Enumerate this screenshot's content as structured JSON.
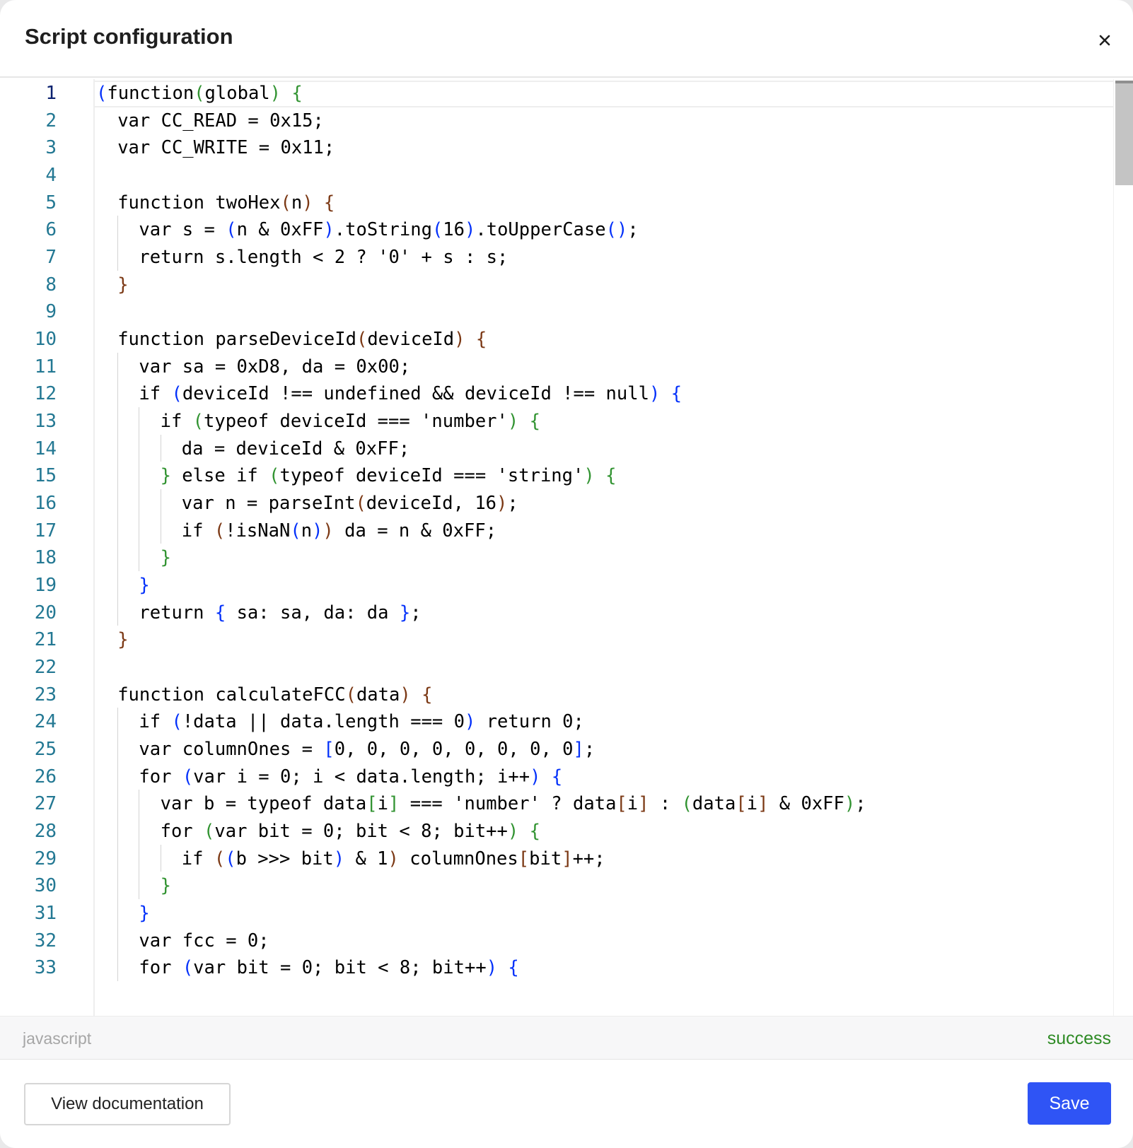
{
  "dialog": {
    "title": "Script configuration"
  },
  "editor": {
    "language": "javascript",
    "status": "success",
    "active_line": 1,
    "lines": [
      {
        "n": "1",
        "indent": 0,
        "parts": [
          [
            "(",
            "b1"
          ],
          [
            "function",
            ""
          ],
          [
            "(",
            "b2"
          ],
          [
            "global",
            ""
          ],
          [
            ")",
            "b2"
          ],
          [
            " ",
            ""
          ],
          [
            "{",
            "b2"
          ]
        ]
      },
      {
        "n": "2",
        "indent": 1,
        "parts": [
          [
            "var CC_READ = 0x15;",
            ""
          ]
        ]
      },
      {
        "n": "3",
        "indent": 1,
        "parts": [
          [
            "var CC_WRITE = 0x11;",
            ""
          ]
        ]
      },
      {
        "n": "4",
        "indent": 0,
        "parts": []
      },
      {
        "n": "5",
        "indent": 1,
        "parts": [
          [
            "function twoHex",
            ""
          ],
          [
            "(",
            "b3"
          ],
          [
            "n",
            ""
          ],
          [
            ")",
            "b3"
          ],
          [
            " ",
            ""
          ],
          [
            "{",
            "b3"
          ]
        ]
      },
      {
        "n": "6",
        "indent": 2,
        "parts": [
          [
            "var s = ",
            ""
          ],
          [
            "(",
            "b1"
          ],
          [
            "n & 0xFF",
            ""
          ],
          [
            ")",
            "b1"
          ],
          [
            ".toString",
            ""
          ],
          [
            "(",
            "b1"
          ],
          [
            "16",
            ""
          ],
          [
            ")",
            "b1"
          ],
          [
            ".toUpperCase",
            ""
          ],
          [
            "()",
            "b1"
          ],
          [
            ";",
            ""
          ]
        ]
      },
      {
        "n": "7",
        "indent": 2,
        "parts": [
          [
            "return s.length < 2 ? '0' + s : s;",
            ""
          ]
        ]
      },
      {
        "n": "8",
        "indent": 1,
        "parts": [
          [
            "}",
            "b3"
          ]
        ]
      },
      {
        "n": "9",
        "indent": 0,
        "parts": []
      },
      {
        "n": "10",
        "indent": 1,
        "parts": [
          [
            "function parseDeviceId",
            ""
          ],
          [
            "(",
            "b3"
          ],
          [
            "deviceId",
            ""
          ],
          [
            ")",
            "b3"
          ],
          [
            " ",
            ""
          ],
          [
            "{",
            "b3"
          ]
        ]
      },
      {
        "n": "11",
        "indent": 2,
        "parts": [
          [
            "var sa = 0xD8, da = 0x00;",
            ""
          ]
        ]
      },
      {
        "n": "12",
        "indent": 2,
        "parts": [
          [
            "if ",
            ""
          ],
          [
            "(",
            "b1"
          ],
          [
            "deviceId !== undefined && deviceId !== null",
            ""
          ],
          [
            ")",
            "b1"
          ],
          [
            " ",
            ""
          ],
          [
            "{",
            "b1"
          ]
        ]
      },
      {
        "n": "13",
        "indent": 3,
        "parts": [
          [
            "if ",
            ""
          ],
          [
            "(",
            "b2"
          ],
          [
            "typeof deviceId === 'number'",
            ""
          ],
          [
            ")",
            "b2"
          ],
          [
            " ",
            ""
          ],
          [
            "{",
            "b2"
          ]
        ]
      },
      {
        "n": "14",
        "indent": 4,
        "parts": [
          [
            "da = deviceId & 0xFF;",
            ""
          ]
        ]
      },
      {
        "n": "15",
        "indent": 3,
        "parts": [
          [
            "}",
            "b2"
          ],
          [
            " else if ",
            ""
          ],
          [
            "(",
            "b2"
          ],
          [
            "typeof deviceId === 'string'",
            ""
          ],
          [
            ")",
            "b2"
          ],
          [
            " ",
            ""
          ],
          [
            "{",
            "b2"
          ]
        ]
      },
      {
        "n": "16",
        "indent": 4,
        "parts": [
          [
            "var n = parseInt",
            ""
          ],
          [
            "(",
            "b3"
          ],
          [
            "deviceId, 16",
            ""
          ],
          [
            ")",
            "b3"
          ],
          [
            ";",
            ""
          ]
        ]
      },
      {
        "n": "17",
        "indent": 4,
        "parts": [
          [
            "if ",
            ""
          ],
          [
            "(",
            "b3"
          ],
          [
            "!isNaN",
            ""
          ],
          [
            "(",
            "b1"
          ],
          [
            "n",
            ""
          ],
          [
            ")",
            "b1"
          ],
          [
            ")",
            "b3"
          ],
          [
            " da = n & 0xFF;",
            ""
          ]
        ]
      },
      {
        "n": "18",
        "indent": 3,
        "parts": [
          [
            "}",
            "b2"
          ]
        ]
      },
      {
        "n": "19",
        "indent": 2,
        "parts": [
          [
            "}",
            "b1"
          ]
        ]
      },
      {
        "n": "20",
        "indent": 2,
        "parts": [
          [
            "return ",
            ""
          ],
          [
            "{",
            "b1"
          ],
          [
            " sa: sa, da: da ",
            ""
          ],
          [
            "}",
            "b1"
          ],
          [
            ";",
            ""
          ]
        ]
      },
      {
        "n": "21",
        "indent": 1,
        "parts": [
          [
            "}",
            "b3"
          ]
        ]
      },
      {
        "n": "22",
        "indent": 0,
        "parts": []
      },
      {
        "n": "23",
        "indent": 1,
        "parts": [
          [
            "function calculateFCC",
            ""
          ],
          [
            "(",
            "b3"
          ],
          [
            "data",
            ""
          ],
          [
            ")",
            "b3"
          ],
          [
            " ",
            ""
          ],
          [
            "{",
            "b3"
          ]
        ]
      },
      {
        "n": "24",
        "indent": 2,
        "parts": [
          [
            "if ",
            ""
          ],
          [
            "(",
            "b1"
          ],
          [
            "!data || data.length === 0",
            ""
          ],
          [
            ")",
            "b1"
          ],
          [
            " return 0;",
            ""
          ]
        ]
      },
      {
        "n": "25",
        "indent": 2,
        "parts": [
          [
            "var columnOnes = ",
            ""
          ],
          [
            "[",
            "b1"
          ],
          [
            "0, 0, 0, 0, 0, 0, 0, 0",
            ""
          ],
          [
            "]",
            "b1"
          ],
          [
            ";",
            ""
          ]
        ]
      },
      {
        "n": "26",
        "indent": 2,
        "parts": [
          [
            "for ",
            ""
          ],
          [
            "(",
            "b1"
          ],
          [
            "var i = 0; i < data.length; i++",
            ""
          ],
          [
            ")",
            "b1"
          ],
          [
            " ",
            ""
          ],
          [
            "{",
            "b1"
          ]
        ]
      },
      {
        "n": "27",
        "indent": 3,
        "parts": [
          [
            "var b = typeof data",
            ""
          ],
          [
            "[",
            "b2"
          ],
          [
            "i",
            ""
          ],
          [
            "]",
            "b2"
          ],
          [
            " === 'number' ? data",
            ""
          ],
          [
            "[",
            "b3"
          ],
          [
            "i",
            ""
          ],
          [
            "]",
            "b3"
          ],
          [
            " : ",
            ""
          ],
          [
            "(",
            "b2"
          ],
          [
            "data",
            ""
          ],
          [
            "[",
            "b3"
          ],
          [
            "i",
            ""
          ],
          [
            "]",
            "b3"
          ],
          [
            " & 0xFF",
            ""
          ],
          [
            ")",
            "b2"
          ],
          [
            ";",
            ""
          ]
        ]
      },
      {
        "n": "28",
        "indent": 3,
        "parts": [
          [
            "for ",
            ""
          ],
          [
            "(",
            "b2"
          ],
          [
            "var bit = 0; bit < 8; bit++",
            ""
          ],
          [
            ")",
            "b2"
          ],
          [
            " ",
            ""
          ],
          [
            "{",
            "b2"
          ]
        ]
      },
      {
        "n": "29",
        "indent": 4,
        "parts": [
          [
            "if ",
            ""
          ],
          [
            "(",
            "b3"
          ],
          [
            "(",
            "b1"
          ],
          [
            "b >>> bit",
            ""
          ],
          [
            ")",
            "b1"
          ],
          [
            " & 1",
            ""
          ],
          [
            ")",
            "b3"
          ],
          [
            " columnOnes",
            ""
          ],
          [
            "[",
            "b3"
          ],
          [
            "bit",
            ""
          ],
          [
            "]",
            "b3"
          ],
          [
            "++;",
            ""
          ]
        ]
      },
      {
        "n": "30",
        "indent": 3,
        "parts": [
          [
            "}",
            "b2"
          ]
        ]
      },
      {
        "n": "31",
        "indent": 2,
        "parts": [
          [
            "}",
            "b1"
          ]
        ]
      },
      {
        "n": "32",
        "indent": 2,
        "parts": [
          [
            "var fcc = 0;",
            ""
          ]
        ]
      },
      {
        "n": "33",
        "indent": 2,
        "parts": [
          [
            "for ",
            ""
          ],
          [
            "(",
            "b1"
          ],
          [
            "var bit = 0; bit < 8; bit++",
            ""
          ],
          [
            ")",
            "b1"
          ],
          [
            " ",
            ""
          ],
          [
            "{",
            "b1"
          ]
        ]
      }
    ]
  },
  "footer": {
    "docs_label": "View documentation",
    "save_label": "Save"
  },
  "icons": {
    "close": "close-icon"
  },
  "colors": {
    "primary": "#2f54f5",
    "success": "#2d8a24",
    "line_number": "#237893",
    "bracket_level_1": "#0431fa",
    "bracket_level_2": "#319331",
    "bracket_level_3": "#7b3814"
  }
}
